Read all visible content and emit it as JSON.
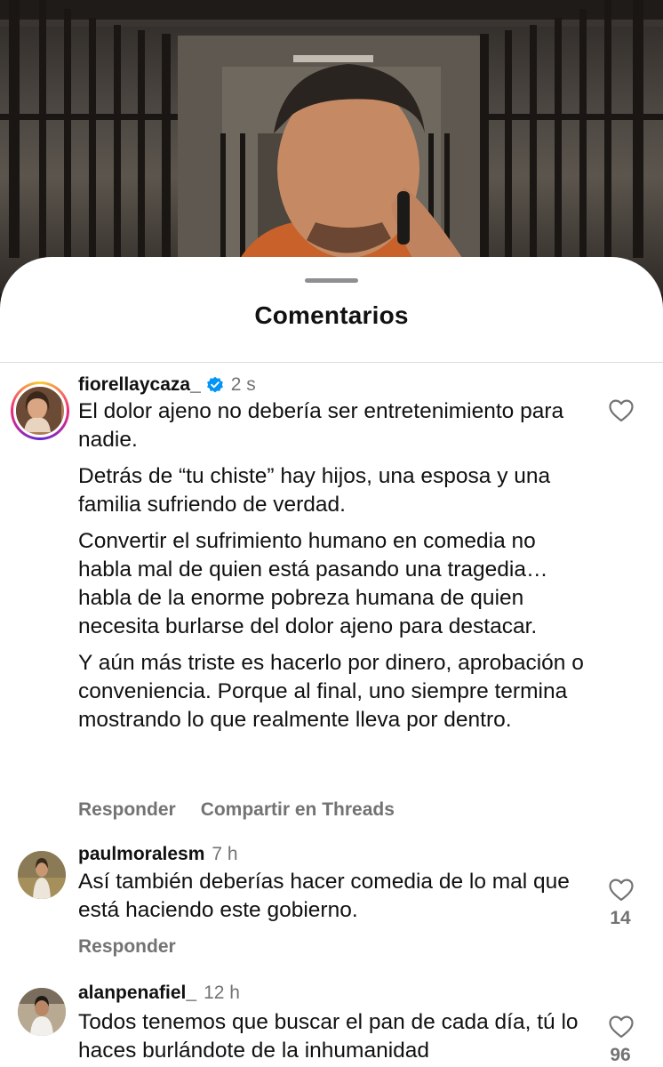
{
  "sheet": {
    "title": "Comentarios"
  },
  "comments": [
    {
      "username": "fiorellaycaza_",
      "verified": true,
      "time": "2 s",
      "paragraphs": [
        "El dolor ajeno no debería ser entretenimiento para nadie.",
        "Detrás de “tu chiste” hay hijos, una esposa y una familia sufriendo de verdad.",
        "Convertir el sufrimiento humano en comedia no habla mal de quien está pasando una tragedia… habla de la enorme pobreza humana de quien necesita burlarse del dolor ajeno para destacar.",
        "Y aún más triste es hacerlo por dinero, aprobación o conveniencia. Porque al final, uno siempre termina mostrando lo que realmente lleva por dentro."
      ],
      "reply_label": "Responder",
      "share_label": "Compartir en Threads",
      "likes": ""
    },
    {
      "username": "paulmoralesm",
      "verified": false,
      "time": "7 h",
      "paragraphs": [
        "Así también deberías hacer comedia de lo mal que está haciendo este gobierno."
      ],
      "reply_label": "Responder",
      "likes": "14"
    },
    {
      "username": "alanpenafiel_",
      "verified": false,
      "time": "12 h",
      "paragraphs": [
        "Todos tenemos que buscar el pan de cada día, tú lo haces burlándote de la inhumanidad"
      ],
      "likes": "96"
    }
  ],
  "icons": {
    "like": "heart-outline-icon",
    "verified": "verified-badge-icon"
  },
  "colors": {
    "verified": "#0095f6",
    "secondary_text": "#737373",
    "divider": "#dbdbdb"
  }
}
